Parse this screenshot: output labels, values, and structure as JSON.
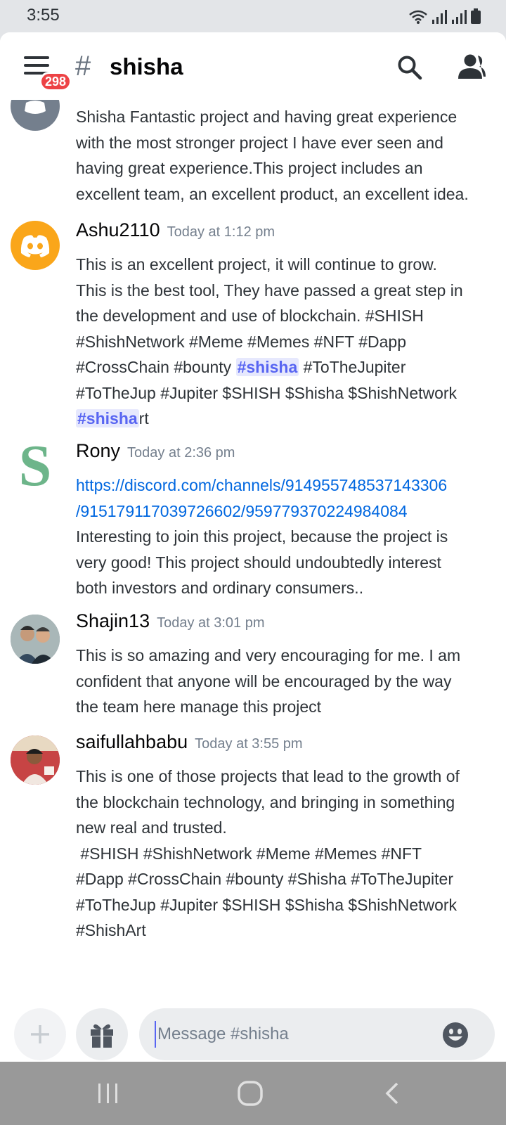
{
  "status_bar": {
    "time": "3:55"
  },
  "header": {
    "badge_count": "298",
    "hash": "#",
    "channel_name": "shisha"
  },
  "messages": [
    {
      "name": "",
      "timestamp": "",
      "lines": [
        "Shisha Fantastic project and having great experience",
        "with the most stronger project I have ever seen and",
        "having great experience.This project includes an",
        "excellent team, an excellent product, an excellent idea."
      ]
    },
    {
      "name": "Ashu2110",
      "timestamp": "Today at 1:12 pm",
      "lines": [
        "This is an excellent project, it will continue to grow.",
        "This is the best tool, They have passed a great step in",
        "the development and use of blockchain. #SHISH",
        "#ShishNetwork #Meme #Memes #NFT #Dapp"
      ],
      "line5_pre": "#CrossChain #bounty ",
      "line5_mention": "#shisha",
      "line5_post": " #ToTheJupiter",
      "line6": "#ToTheJup #Jupiter $SHISH $Shisha $ShishNetwork",
      "line7_mention": "#shisha",
      "line7_post": "rt"
    },
    {
      "name": "Rony",
      "timestamp": "Today at 2:36 pm",
      "link_lines": [
        "https://discord.com/channels/914955748537143306",
        "/915179117039726602/959779370224984084"
      ],
      "lines": [
        "Interesting to join this project, because the project is",
        "very good! This project should undoubtedly interest",
        "both investors and ordinary consumers.."
      ]
    },
    {
      "name": "Shajin13",
      "timestamp": "Today at 3:01 pm",
      "lines": [
        "This is so amazing and very encouraging for me. I am",
        "confident that anyone will be encouraged by the way",
        "the team here manage this project"
      ]
    },
    {
      "name": "saifullahbabu",
      "timestamp": "Today at 3:55 pm",
      "lines": [
        "This is one of those projects that lead to the growth of",
        "the blockchain technology, and bringing in something",
        "new real and trusted.",
        " #SHISH #ShishNetwork #Meme #Memes #NFT",
        "#Dapp #CrossChain #bounty #Shisha #ToTheJupiter",
        "#ToTheJup #Jupiter $SHISH $Shisha $ShishNetwork",
        "#ShishArt"
      ]
    }
  ],
  "avatars": {
    "rony_letter": "S"
  },
  "composer": {
    "placeholder": "Message #shisha"
  },
  "colors": {
    "accent": "#5865f2",
    "link": "#0067e0",
    "badge": "#ed4245",
    "orange_avatar": "#faa61a"
  }
}
